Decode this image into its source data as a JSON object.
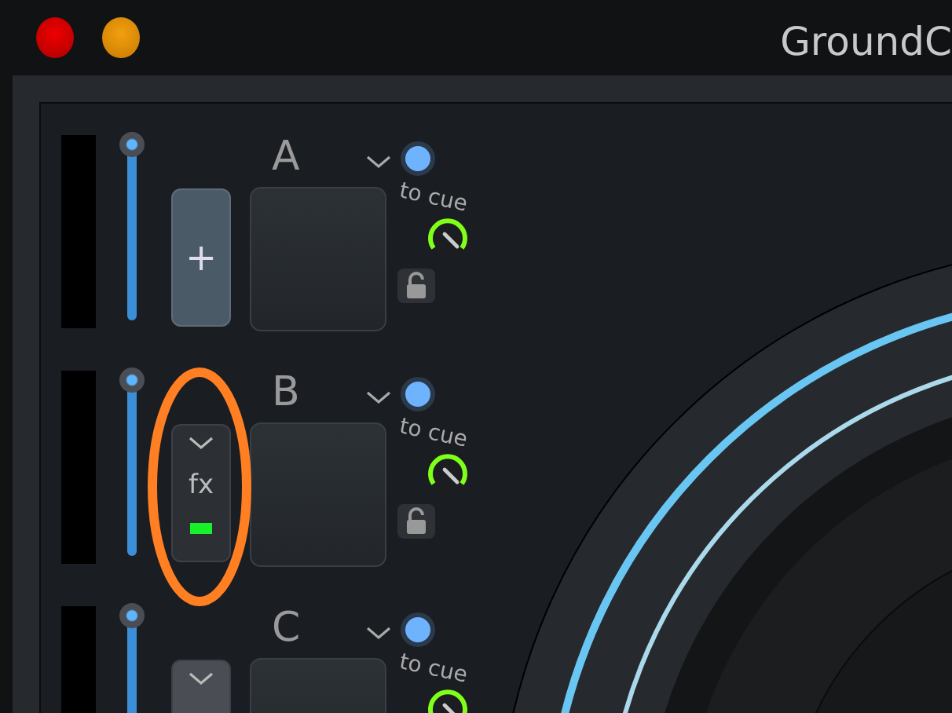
{
  "window": {
    "title": "GroundC"
  },
  "decks": [
    {
      "letter": "A",
      "volume": {
        "level": 1
      },
      "button": {
        "kind": "add",
        "label": "+"
      },
      "cue_label": "to cue"
    },
    {
      "letter": "B",
      "volume": {
        "level": 1
      },
      "button": {
        "kind": "fx",
        "label": "fx",
        "active": true
      },
      "cue_label": "to cue"
    },
    {
      "letter": "C",
      "volume": {
        "level": 1
      },
      "button": {
        "kind": "collapsed"
      },
      "cue_label": "to cue"
    }
  ]
}
